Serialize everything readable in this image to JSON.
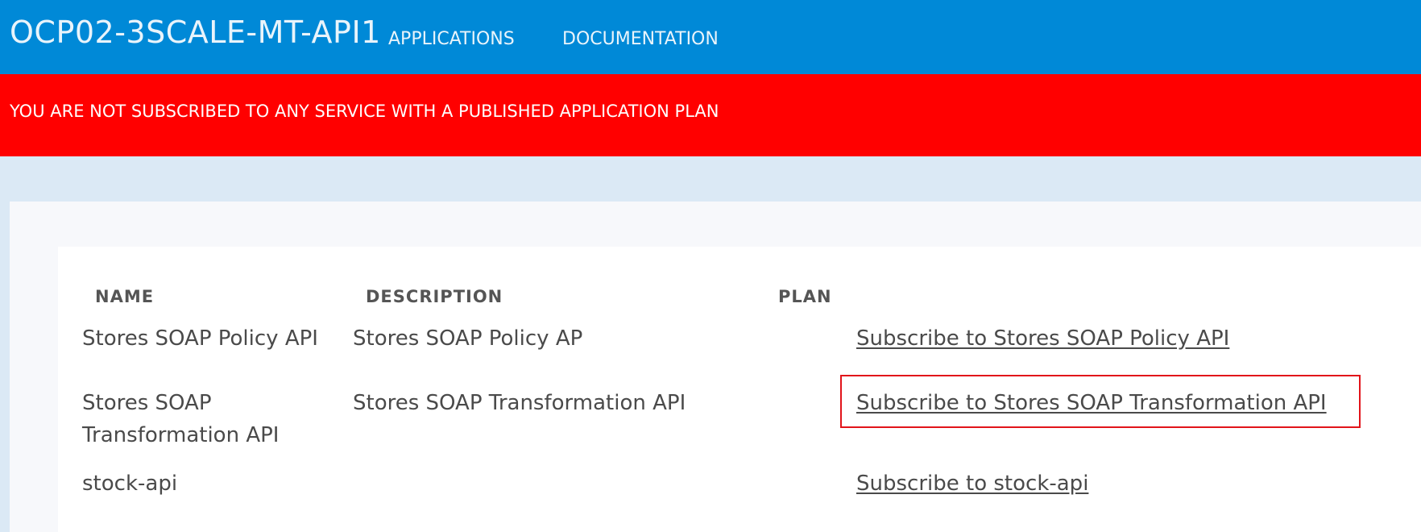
{
  "navbar": {
    "brand": "OCP02-3SCALE-MT-API1",
    "links": [
      "APPLICATIONS",
      "DOCUMENTATION"
    ]
  },
  "alert": {
    "message": "YOU ARE NOT SUBSCRIBED TO ANY SERVICE WITH A PUBLISHED APPLICATION PLAN"
  },
  "table": {
    "columns": [
      "NAME",
      "DESCRIPTION",
      "PLAN"
    ],
    "rows": [
      {
        "name": "Stores SOAP Policy API",
        "description": "Stores SOAP Policy AP",
        "plan_link": "Subscribe to Stores SOAP Policy API"
      },
      {
        "name": "Stores SOAP Transformation API",
        "description": "Stores SOAP Transformation API",
        "plan_link": "Subscribe to Stores SOAP Transformation API"
      },
      {
        "name": "stock-api",
        "description": "",
        "plan_link": "Subscribe to stock-api"
      }
    ]
  },
  "colors": {
    "navbar": "#0089d7",
    "alert": "#ff0000",
    "highlight": "#e2141a",
    "page_background": "#dbe9f5"
  }
}
